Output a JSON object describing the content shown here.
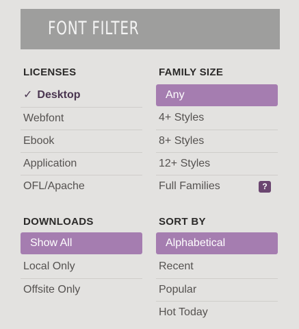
{
  "header": {
    "title": "FONT FILTER"
  },
  "licenses": {
    "title": "LICENSES",
    "items": [
      {
        "label": "Desktop",
        "check": "✓"
      },
      {
        "label": "Webfont"
      },
      {
        "label": "Ebook"
      },
      {
        "label": "Application"
      },
      {
        "label": "OFL/Apache"
      }
    ]
  },
  "family_size": {
    "title": "FAMILY SIZE",
    "items": [
      {
        "label": "Any"
      },
      {
        "label": "4+ Styles"
      },
      {
        "label": "8+ Styles"
      },
      {
        "label": "12+ Styles"
      },
      {
        "label": "Full Families",
        "help": "?"
      }
    ]
  },
  "downloads": {
    "title": "DOWNLOADS",
    "items": [
      {
        "label": "Show All"
      },
      {
        "label": "Local Only"
      },
      {
        "label": "Offsite Only"
      }
    ]
  },
  "sort_by": {
    "title": "SORT BY",
    "items": [
      {
        "label": "Alphabetical"
      },
      {
        "label": "Recent"
      },
      {
        "label": "Popular"
      },
      {
        "label": "Hot Today"
      }
    ]
  },
  "colors": {
    "accent": "#a57db0",
    "header_bg": "#9e9e9d",
    "page_bg": "#e3e2e0",
    "help_bg": "#6b4670"
  },
  "icons": {
    "check": "checkmark-icon",
    "help": "question-icon"
  }
}
